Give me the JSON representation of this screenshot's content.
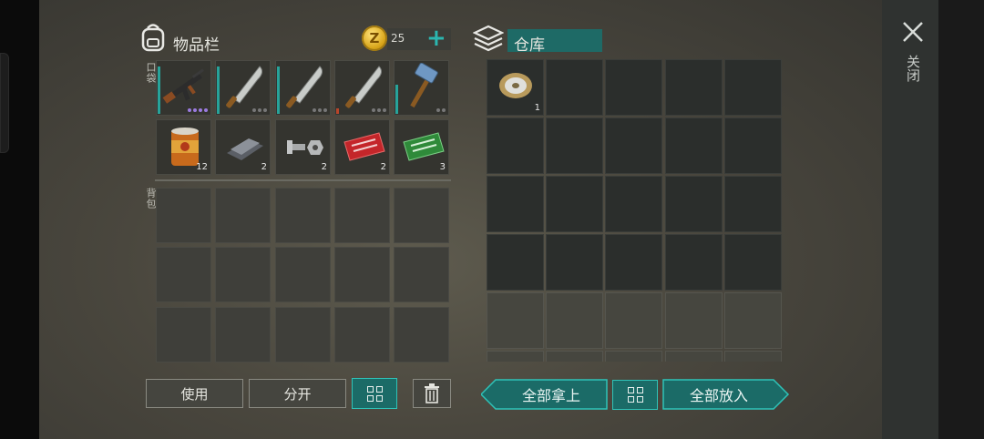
{
  "inventory": {
    "title": "物品栏",
    "coins": "25",
    "pockets_label": "口袋",
    "backpack_label": "背包",
    "pocket_items": [
      {
        "icon": "assault-rifle-icon",
        "qty": ""
      },
      {
        "icon": "machete-icon",
        "qty": ""
      },
      {
        "icon": "machete-icon",
        "qty": ""
      },
      {
        "icon": "machete-icon",
        "qty": ""
      },
      {
        "icon": "sledgehammer-icon",
        "qty": ""
      },
      {
        "icon": "canned-food-icon",
        "qty": "12"
      },
      {
        "icon": "iron-ingot-icon",
        "qty": "2"
      },
      {
        "icon": "bolt-nut-icon",
        "qty": "2"
      },
      {
        "icon": "red-coupon-icon",
        "qty": "2"
      },
      {
        "icon": "green-coupon-icon",
        "qty": "3"
      }
    ]
  },
  "warehouse": {
    "title": "仓库",
    "items": [
      {
        "icon": "wire-spool-icon",
        "qty": "1"
      }
    ]
  },
  "buttons": {
    "use": "使用",
    "split": "分开",
    "take_all": "全部拿上",
    "put_all": "全部放入",
    "close": "关闭"
  },
  "colors": {
    "accent": "#1b6b67",
    "accent_border": "#2ec3b8"
  }
}
